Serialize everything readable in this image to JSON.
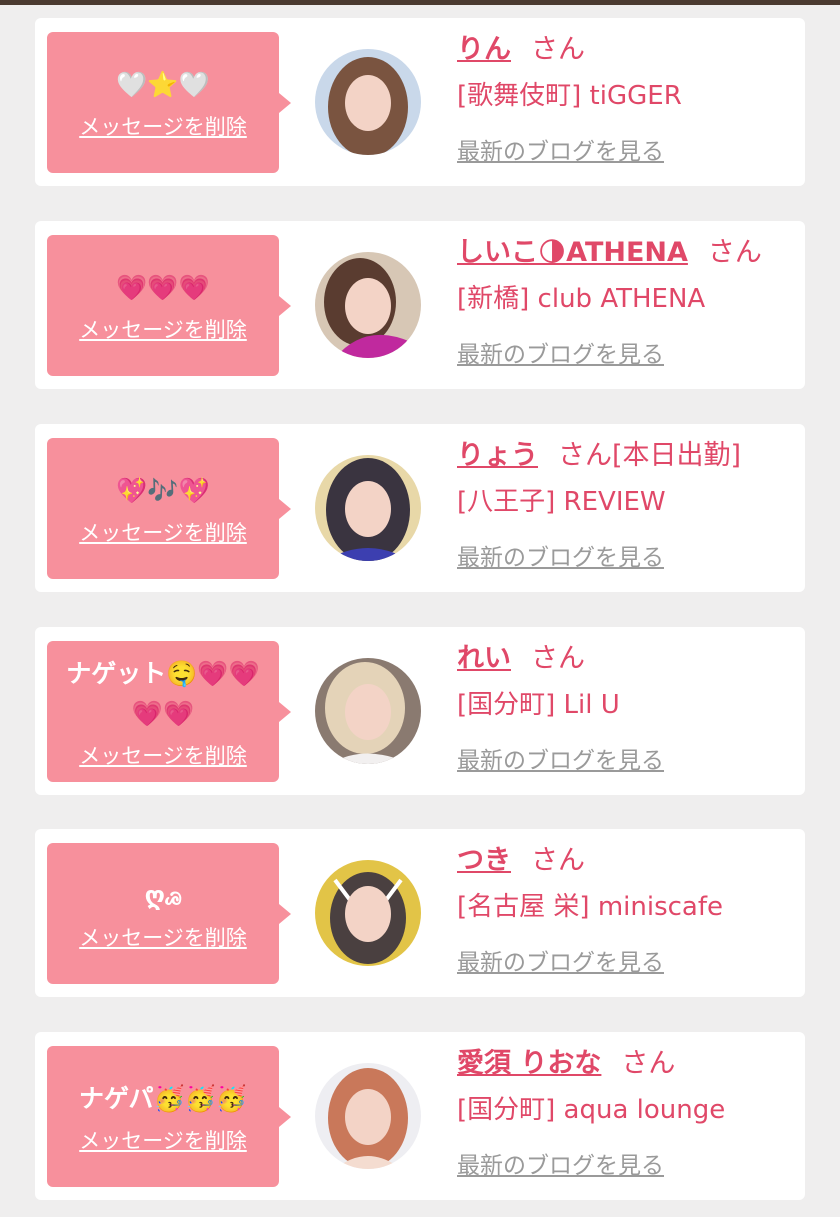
{
  "colors": {
    "accent": "#e04868",
    "bubble": "#f7909c",
    "background": "#efeeee"
  },
  "cards": [
    {
      "message": "🤍⭐🤍",
      "delete_label": "メッセージを削除",
      "name": "りん",
      "suffix": "さん",
      "shop": "[歌舞伎町] tiGGER",
      "blog_label": "最新のブログを見る",
      "avatar_icon": "profile-photo"
    },
    {
      "message": "💗💗💗",
      "delete_label": "メッセージを削除",
      "name": "しいこ🌗ATHENA",
      "suffix": "さん",
      "shop": "[新橋] club ATHENA",
      "blog_label": "最新のブログを見る",
      "avatar_icon": "profile-photo"
    },
    {
      "message": "💖🎶💖",
      "delete_label": "メッセージを削除",
      "name": "りょう",
      "suffix": "さん[本日出勤]",
      "shop": "[八王子] REVIEW",
      "blog_label": "最新のブログを見る",
      "avatar_icon": "profile-photo"
    },
    {
      "message": "ナゲット🤤💗💗💗💗",
      "delete_label": "メッセージを削除",
      "name": "れい",
      "suffix": "さん",
      "shop": "[国分町] Lil U",
      "blog_label": "最新のブログを見る",
      "avatar_icon": "profile-photo"
    },
    {
      "message": "ღꮚ",
      "delete_label": "メッセージを削除",
      "name": "つき",
      "suffix": "さん",
      "shop": "[名古屋 栄] miniscafe",
      "blog_label": "最新のブログを見る",
      "avatar_icon": "profile-photo"
    },
    {
      "message": "ナゲパ🥳🥳🥳",
      "delete_label": "メッセージを削除",
      "name": "愛須 りおな",
      "suffix": "さん",
      "shop": "[国分町] aqua lounge",
      "blog_label": "最新のブログを見る",
      "avatar_icon": "profile-photo"
    }
  ]
}
